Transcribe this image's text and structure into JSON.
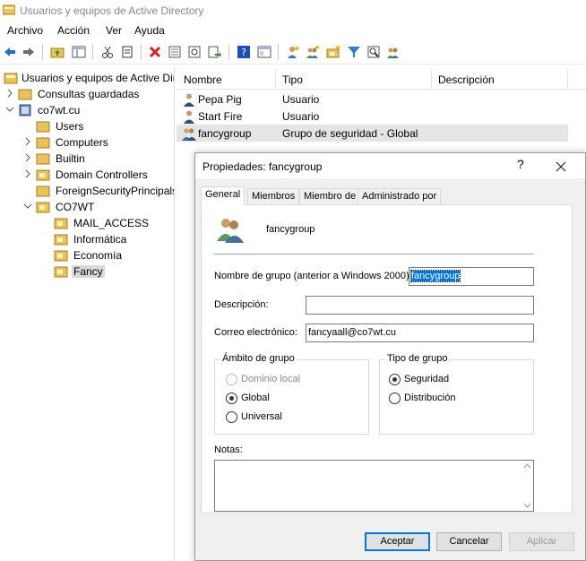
{
  "window": {
    "title": "Usuarios y equipos de Active Directory"
  },
  "menu": [
    "Archivo",
    "Acción",
    "Ver",
    "Ayuda"
  ],
  "toolbar_icons": [
    "back-arrow-icon",
    "forward-arrow-icon",
    "up-folder-icon",
    "show-hide-tree-icon",
    "cut-icon",
    "copy-icon",
    "delete-icon",
    "properties-icon",
    "refresh-icon",
    "export-list-icon",
    "help-icon",
    "mmc-console-icon",
    "new-user-icon",
    "new-group-icon",
    "new-ou-icon",
    "filter-icon",
    "find-icon",
    "add-to-group-icon"
  ],
  "tree": {
    "root": "Usuarios y equipos de Active Dir",
    "saved_queries": "Consultas guardadas",
    "domain": "co7wt.cu",
    "children": [
      "Users",
      "Computers",
      "Builtin",
      "Domain Controllers",
      "ForeignSecurityPrincipals",
      "CO7WT"
    ],
    "co7wt_children": [
      "MAIL_ACCESS",
      "Informática",
      "Economía",
      "Fancy"
    ]
  },
  "list": {
    "columns": [
      "Nombre",
      "Tipo",
      "Descripción"
    ],
    "rows": [
      {
        "name": "Pepa Pig",
        "type": "Usuario",
        "icon": "user-icon"
      },
      {
        "name": "Start Fire",
        "type": "Usuario",
        "icon": "user-icon"
      },
      {
        "name": "fancygroup",
        "type": "Grupo de seguridad - Global",
        "icon": "group-icon"
      }
    ]
  },
  "dialog": {
    "title": "Propiedades: fancygroup",
    "help": "?",
    "tabs": [
      "General",
      "Miembros",
      "Miembro de",
      "Administrado por"
    ],
    "group_name": "fancygroup",
    "prewin_label": "Nombre de grupo (anterior a Windows 2000):",
    "prewin_value": "fancygroup",
    "description_label": "Descripción:",
    "description_value": "",
    "email_label": "Correo electrónico:",
    "email_value": "fancyaall@co7wt.cu",
    "scope": {
      "legend": "Ámbito de grupo",
      "options": [
        "Dominio local",
        "Global",
        "Universal"
      ],
      "selected": "Global"
    },
    "type": {
      "legend": "Tipo de grupo",
      "options": [
        "Seguridad",
        "Distribución"
      ],
      "selected": "Seguridad"
    },
    "notes_label": "Notas:",
    "buttons": {
      "ok": "Aceptar",
      "cancel": "Cancelar",
      "apply": "Aplicar"
    }
  }
}
